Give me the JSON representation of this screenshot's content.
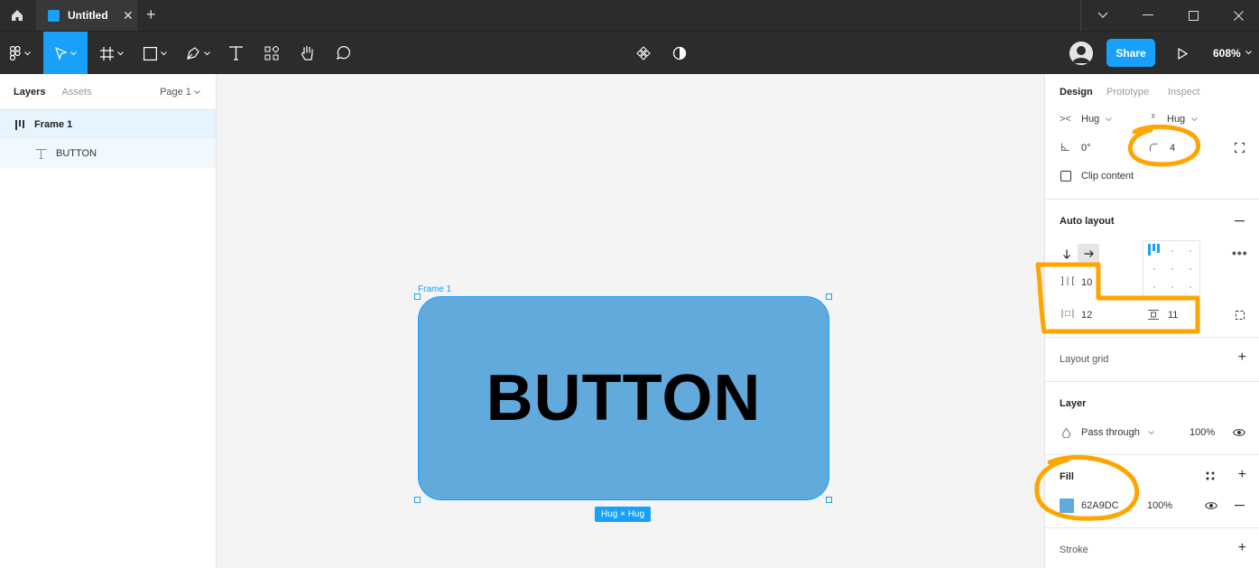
{
  "titlebar": {
    "home_icon": "home-icon",
    "tab_title": "Untitled",
    "tab_close": "✕",
    "new_tab": "+",
    "window_buttons": [
      "⌄",
      "—",
      "☐",
      "✕"
    ]
  },
  "toolbar": {
    "share_label": "Share",
    "zoom_label": "608%",
    "tools": [
      "figma-menu-icon",
      "move-tool-icon",
      "frame-tool-icon",
      "shape-tool-icon",
      "pen-tool-icon",
      "text-tool-icon",
      "resources-icon",
      "hand-tool-icon",
      "comment-tool-icon"
    ],
    "center_tools": [
      "component-icon",
      "contrast-icon"
    ],
    "right_tools": [
      "avatar",
      "present-icon"
    ]
  },
  "left_panel": {
    "tabs": [
      "Layers",
      "Assets"
    ],
    "page_selector": "Page 1",
    "layers": [
      {
        "name": "Frame 1",
        "icon": "auto-layout-frame-icon",
        "selected": true
      },
      {
        "name": "BUTTON",
        "icon": "text-layer-icon",
        "selected": false
      }
    ]
  },
  "canvas": {
    "frame_label": "Frame 1",
    "button_text": "BUTTON",
    "size_badge": "Hug × Hug",
    "frame_fill": "#62A9DC",
    "selection_color": "#18A0FB"
  },
  "right_panel": {
    "tabs": [
      "Design",
      "Prototype",
      "Inspect"
    ],
    "width_mode": "Hug",
    "height_mode": "Hug",
    "rotation": "0°",
    "corner_radius": "4",
    "clip_content_label": "Clip content",
    "auto_layout": {
      "title": "Auto layout",
      "item_spacing": "10",
      "padding_horizontal": "12",
      "padding_vertical": "11"
    },
    "layout_grid_title": "Layout grid",
    "layer": {
      "title": "Layer",
      "blend_mode": "Pass through",
      "opacity": "100%"
    },
    "fill": {
      "title": "Fill",
      "hex": "62A9DC",
      "opacity": "100%",
      "color": "#62A9DC"
    },
    "stroke_title": "Stroke"
  },
  "annotations": {
    "color": "#FFA500"
  }
}
